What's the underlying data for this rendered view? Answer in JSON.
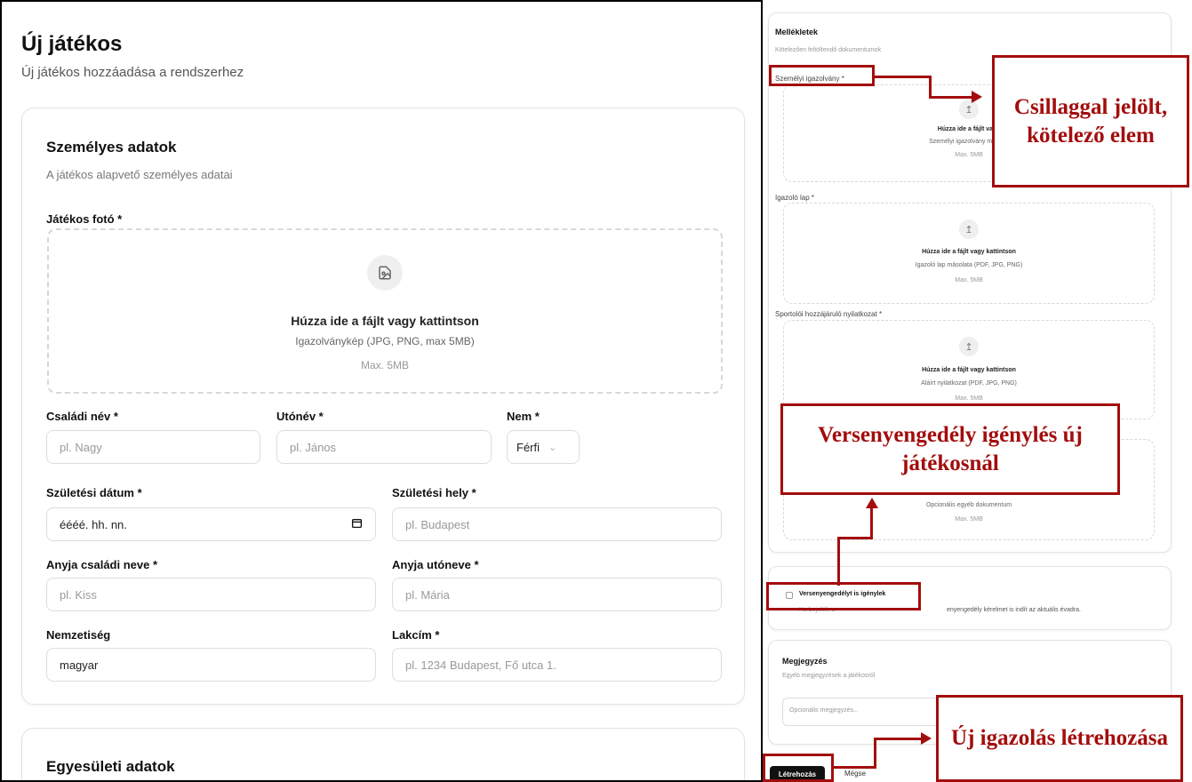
{
  "header": {
    "title": "Új játékos",
    "subtitle": "Új játékos hozzáadása a rendszerhez"
  },
  "personal": {
    "title": "Személyes adatok",
    "subtitle": "A játékos alapvető személyes adatai",
    "photo_label": "Játékos fotó *",
    "photo_drop_main": "Húzza ide a fájlt vagy kattintson",
    "photo_drop_hint": "Igazolványkép (JPG, PNG, max 5MB)",
    "photo_drop_max": "Max. 5MB",
    "fields": {
      "last_name": {
        "label": "Családi név *",
        "placeholder": "pl. Nagy"
      },
      "first_name": {
        "label": "Utónév *",
        "placeholder": "pl. János"
      },
      "gender": {
        "label": "Nem *",
        "value": "Férfi"
      },
      "birth_date": {
        "label": "Születési dátum *",
        "value": "éééé. hh. nn."
      },
      "birth_place": {
        "label": "Születési hely *",
        "placeholder": "pl. Budapest"
      },
      "mother_last": {
        "label": "Anyja családi neve *",
        "placeholder": "pl. Kiss"
      },
      "mother_first": {
        "label": "Anyja utóneve *",
        "placeholder": "pl. Mária"
      },
      "nationality": {
        "label": "Nemzetiség",
        "value": "magyar"
      },
      "address": {
        "label": "Lakcím *",
        "placeholder": "pl. 1234 Budapest, Fő utca 1."
      }
    }
  },
  "club": {
    "title": "Egyesületi adatok"
  },
  "attachments": {
    "title": "Mellékletek",
    "subtitle": "Kötelezően feltöltendő dokumentumok",
    "id_card_label": "Személyi igazolvány *",
    "id_card_main": "Húzza ide a fájlt vagy",
    "id_card_hint": "Személyi igazolvány másolat",
    "id_card_max": "Max. 5MB",
    "cert_label": "Igazoló lap *",
    "cert_main": "Húzza ide a fájlt vagy kattintson",
    "cert_hint": "Igazoló lap másolata (PDF, JPG, PNG)",
    "cert_max": "Max. 5MB",
    "consent_label": "Sportolói hozzájáruló nyilatkozat *",
    "consent_main": "Húzza ide a fájlt vagy kattintson",
    "consent_hint": "Aláírt nyilatkozat (PDF, JPG, PNG)",
    "consent_max": "Max. 5MB",
    "other_hint": "Opcionális egyéb dokumentum",
    "other_max": "Max. 5MB"
  },
  "license": {
    "checkbox_label": "Versenyengedélyt is igénylek",
    "note_start": "Ha bejelöli, a",
    "note_end": "enyengedély kérelmet is indít az aktuális évadra."
  },
  "notes": {
    "title": "Megjegyzés",
    "subtitle": "Egyéb megjegyzések a játékosról",
    "placeholder": "Opcionális megjegyzés..."
  },
  "actions": {
    "create": "Létrehozás",
    "cancel": "Mégse"
  },
  "callouts": {
    "required": "Csillaggal jelölt, kötelező elem",
    "license": "Versenyengedély igénylés új játékosnál",
    "create": "Új igazolás létrehozása"
  },
  "colors": {
    "accent": "#a30d0d",
    "button_bg": "#111111"
  }
}
